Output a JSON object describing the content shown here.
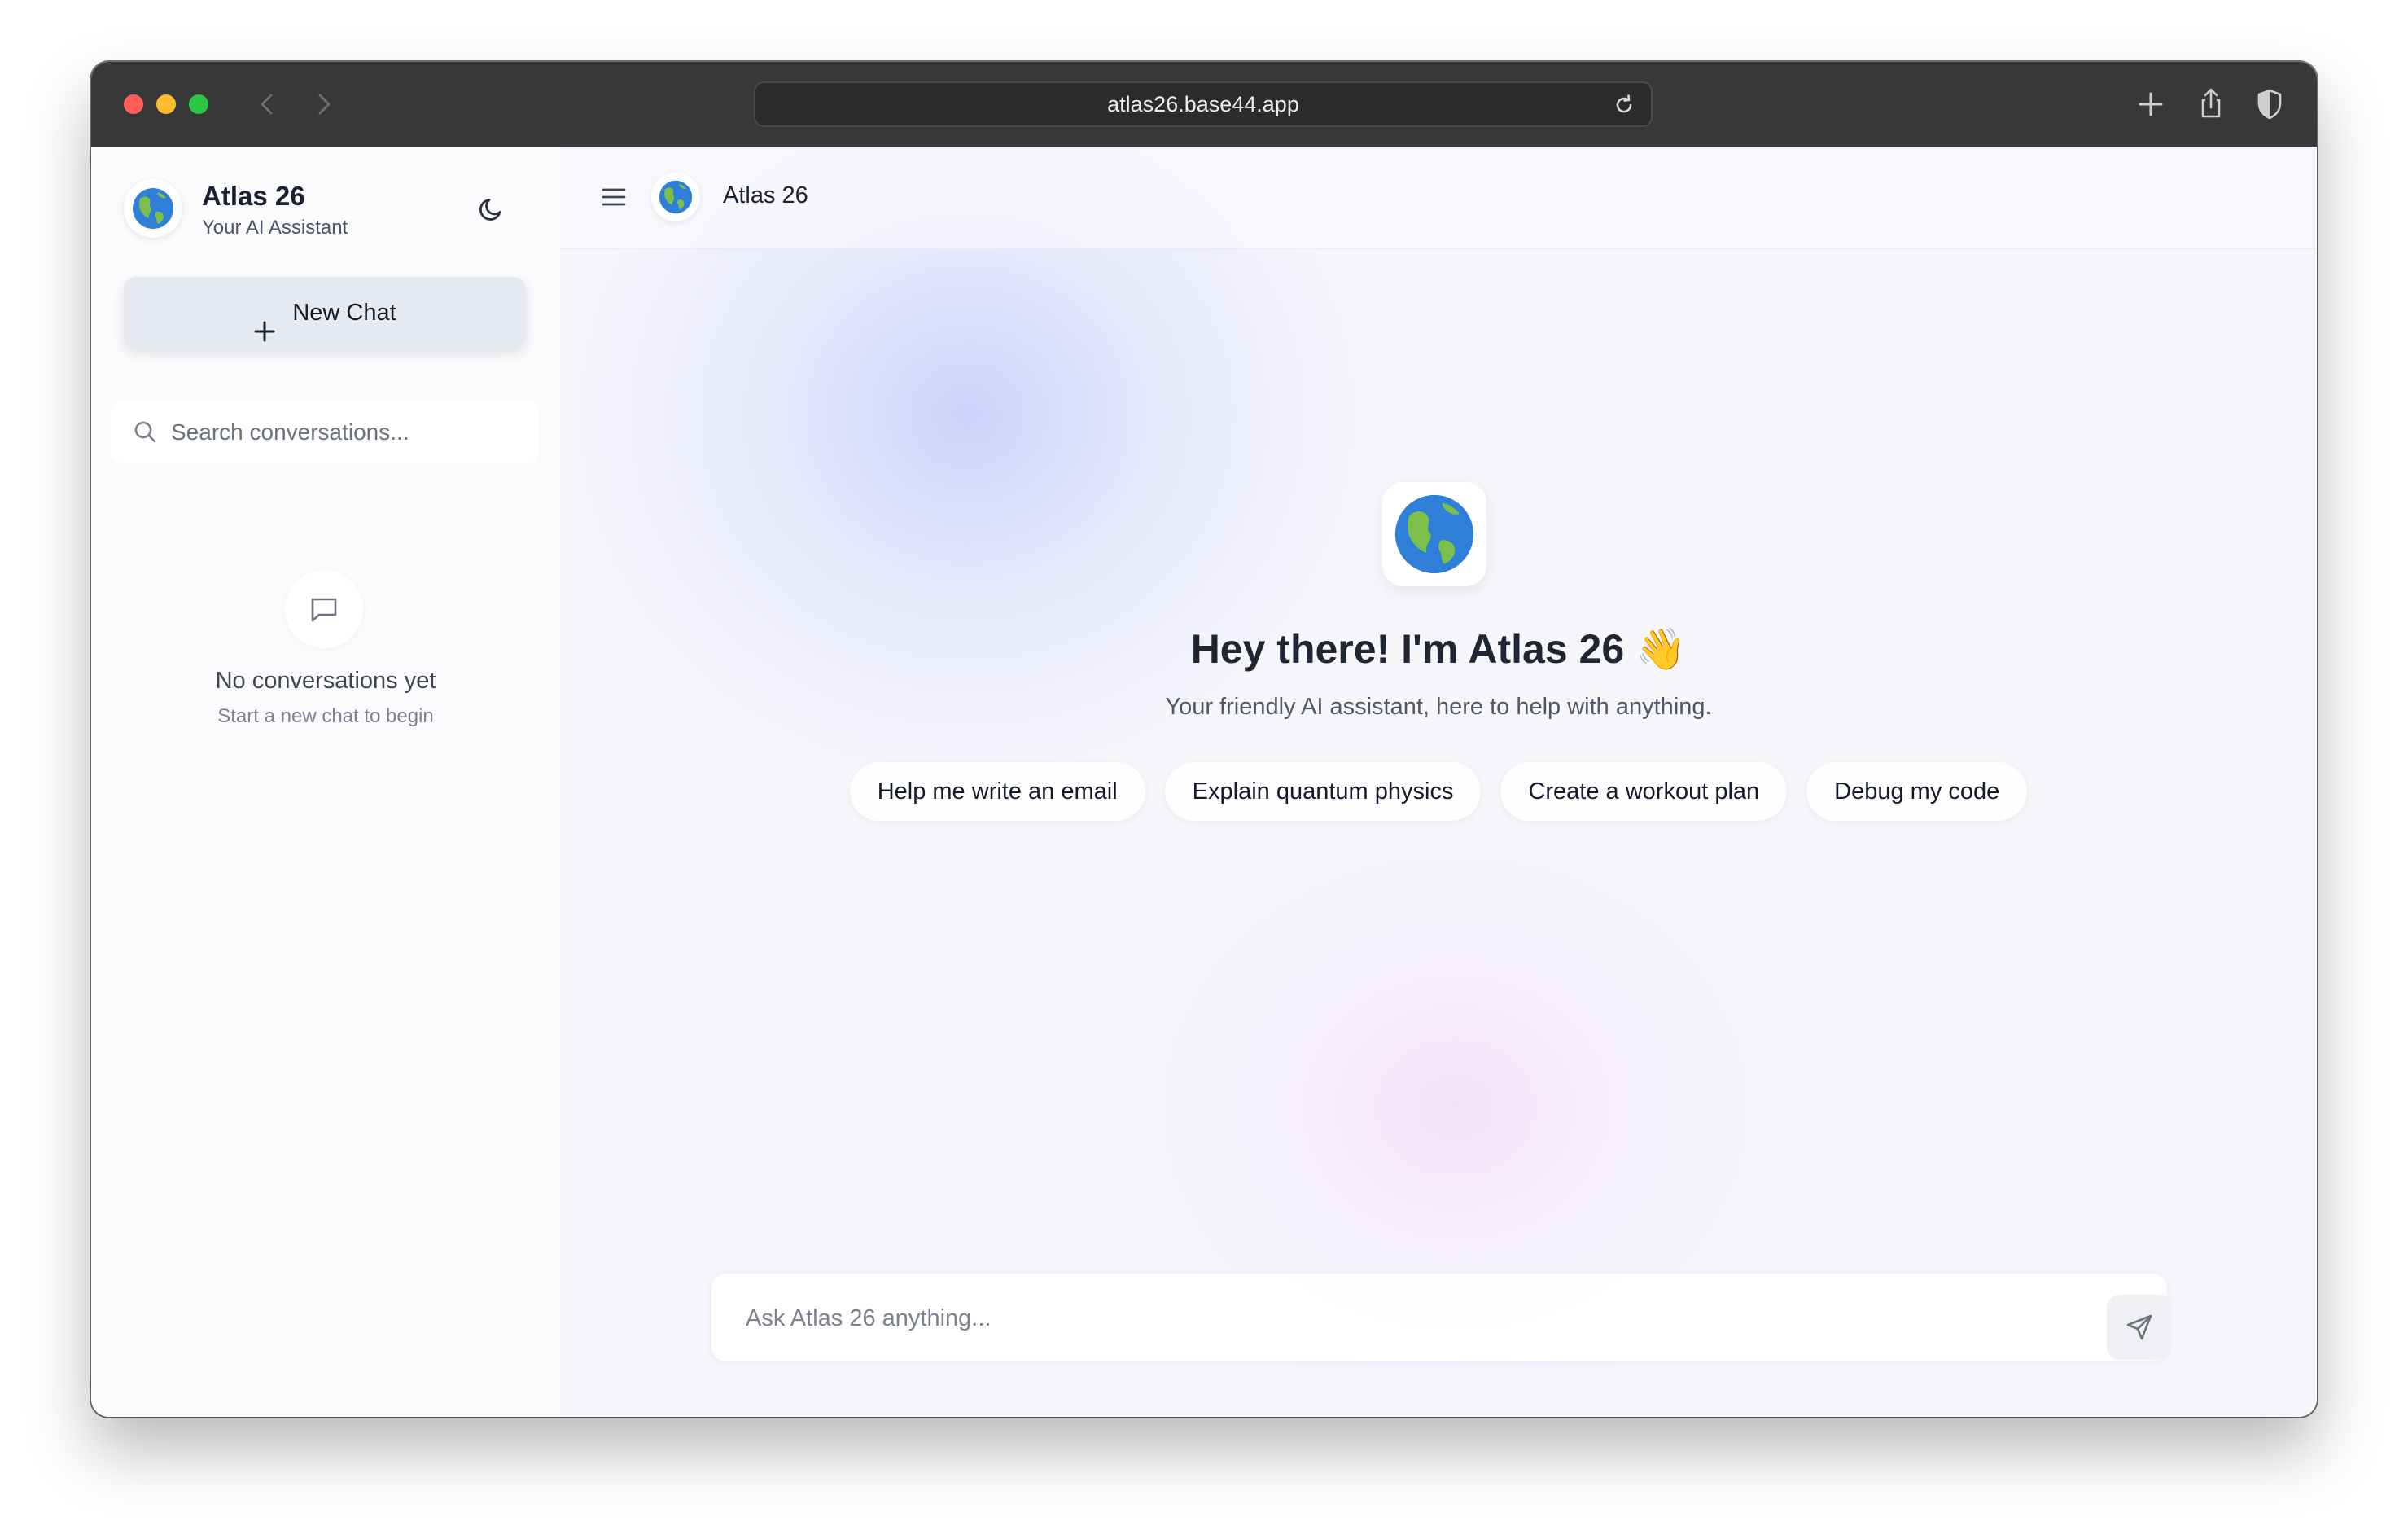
{
  "browser": {
    "url": "atlas26.base44.app"
  },
  "sidebar": {
    "brand_title": "Atlas 26",
    "brand_subtitle": "Your AI Assistant",
    "new_chat_label": "New Chat",
    "search_placeholder": "Search conversations...",
    "empty_title": "No conversations yet",
    "empty_subtitle": "Start a new chat to begin"
  },
  "header": {
    "title": "Atlas 26"
  },
  "hero": {
    "title": "Hey there! I'm Atlas 26 👋",
    "subtitle": "Your friendly AI assistant, here to help with anything."
  },
  "suggestions": [
    {
      "label": "Help me write an email"
    },
    {
      "label": "Explain quantum physics"
    },
    {
      "label": "Create a workout plan"
    },
    {
      "label": "Debug my code"
    }
  ],
  "composer": {
    "placeholder": "Ask Atlas 26 anything..."
  },
  "icons": {
    "logo": "globe-icon",
    "theme": "moon-icon",
    "search": "search-icon",
    "empty": "message-square-icon",
    "menu": "menu-icon",
    "send": "send-icon"
  },
  "colors": {
    "titlebar": "#383838",
    "accent_blob": "#aab4fa",
    "pink_blob": "#eed2f6",
    "new_chat_bg": "#e6e9ef"
  }
}
